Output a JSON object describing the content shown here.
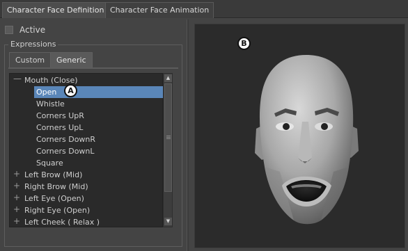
{
  "tabs": [
    {
      "label": "Character Face Definition",
      "active": true
    },
    {
      "label": "Character Face Animation",
      "active": false
    }
  ],
  "active_checkbox": {
    "label": "Active",
    "checked": false
  },
  "expressions": {
    "group_title": "Expressions",
    "subtabs": [
      {
        "label": "Custom",
        "active": false
      },
      {
        "label": "Generic",
        "active": true
      }
    ],
    "tree": [
      {
        "label": "Mouth (Close)",
        "expanded": true,
        "children": [
          {
            "label": "Open",
            "selected": true
          },
          {
            "label": "Whistle"
          },
          {
            "label": "Corners UpR"
          },
          {
            "label": "Corners UpL"
          },
          {
            "label": "Corners DownR"
          },
          {
            "label": "Corners DownL"
          },
          {
            "label": "Square"
          }
        ]
      },
      {
        "label": "Left Brow (Mid)",
        "expanded": false
      },
      {
        "label": "Right Brow (Mid)",
        "expanded": false
      },
      {
        "label": "Left Eye (Open)",
        "expanded": false
      },
      {
        "label": "Right Eye (Open)",
        "expanded": false
      },
      {
        "label": "Left Cheek ( Relax )",
        "expanded": false
      }
    ]
  },
  "callouts": {
    "a": "A",
    "b": "B"
  },
  "colors": {
    "selection": "#5a86b8",
    "viewport_bg": "#2b2b2b",
    "panel_bg": "#444444"
  }
}
